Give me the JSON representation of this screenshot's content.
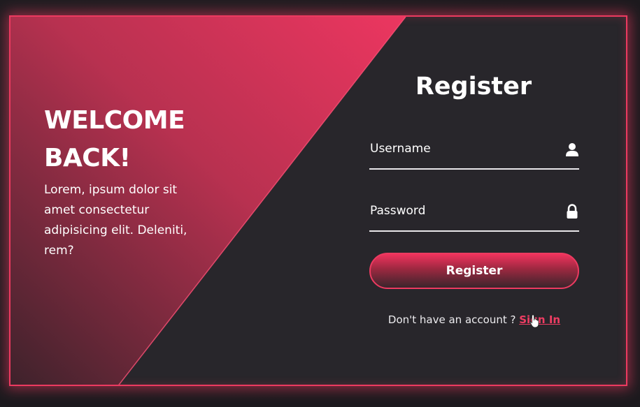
{
  "colors": {
    "accent": "#ec3a60",
    "panel_dark": "#28262b",
    "panel_gradient_top": "#e8385e",
    "panel_gradient_bottom": "#4a2530",
    "text": "#ffffff"
  },
  "welcome": {
    "title_line1": "WELCOME",
    "title_line2": "BACK!",
    "body": "Lorem, ipsum dolor sit amet consectetur adipisicing elit. Deleniti, rem?"
  },
  "form": {
    "title": "Register",
    "username": {
      "placeholder": "Username",
      "icon": "user-icon"
    },
    "password": {
      "placeholder": "Password",
      "icon": "lock-icon"
    },
    "submit_label": "Register",
    "footer_text": "Don't have an account ?",
    "signin_label": "Sign In"
  }
}
